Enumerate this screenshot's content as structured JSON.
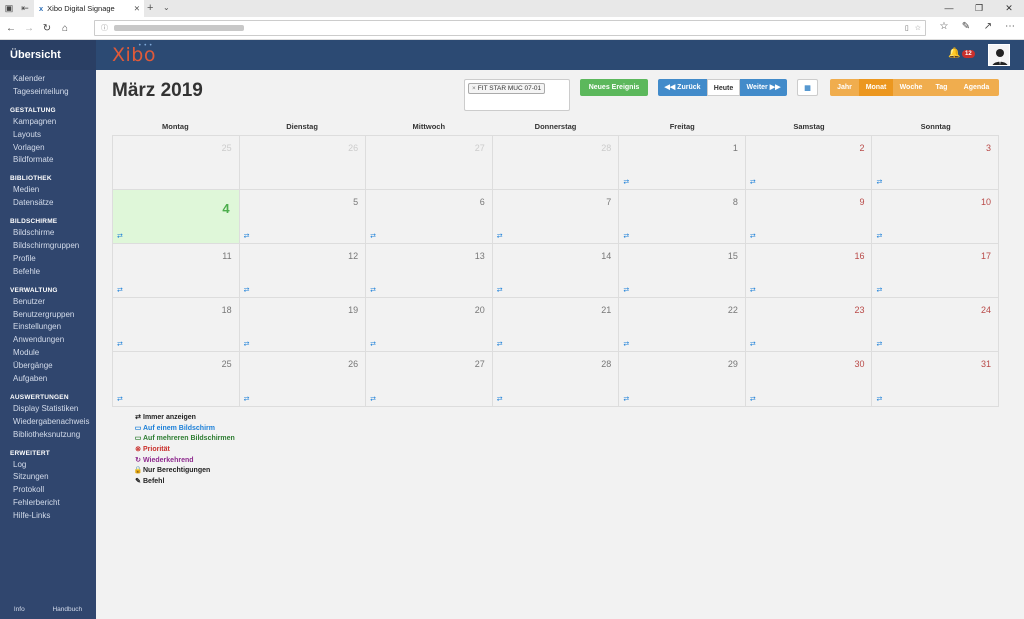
{
  "browser": {
    "tab_title": "Xibo Digital Signage",
    "tab_close": "✕",
    "new_tab": "+",
    "tab_dropdown": "⌄",
    "window_controls": [
      "—",
      "❐",
      "✕"
    ]
  },
  "sidebar": {
    "title": "Übersicht",
    "sections": [
      {
        "heading": "",
        "items": [
          "Kalender",
          "Tageseinteilung"
        ]
      },
      {
        "heading": "GESTALTUNG",
        "items": [
          "Kampagnen",
          "Layouts",
          "Vorlagen",
          "Bildformate"
        ]
      },
      {
        "heading": "BIBLIOTHEK",
        "items": [
          "Medien",
          "Datensätze"
        ]
      },
      {
        "heading": "BILDSCHIRME",
        "items": [
          "Bildschirme",
          "Bildschirmgruppen",
          "Profile",
          "Befehle"
        ]
      },
      {
        "heading": "VERWALTUNG",
        "items": [
          "Benutzer",
          "Benutzergruppen",
          "Einstellungen",
          "Anwendungen",
          "Module",
          "Übergänge",
          "Aufgaben"
        ]
      },
      {
        "heading": "AUSWERTUNGEN",
        "items": [
          "Display Statistiken",
          "Wiedergabenachweis",
          "Bibliotheksnutzung"
        ]
      },
      {
        "heading": "ERWEITERT",
        "items": [
          "Log",
          "Sitzungen",
          "Protokoll",
          "Fehlerbericht",
          "Hilfe-Links"
        ]
      }
    ],
    "footer": {
      "info": "Info",
      "manual": "Handbuch"
    }
  },
  "header": {
    "logo": "Xibo",
    "notification_count": "12"
  },
  "calendar": {
    "title": "März 2019",
    "filter_tag": "FIT STAR MUC 07-01",
    "filter_remove": "×",
    "new_event": "Neues Ereignis",
    "prev": "◀◀ Zurück",
    "today": "Heute",
    "next": "Weiter ▶▶",
    "views": [
      "Jahr",
      "Monat",
      "Woche",
      "Tag",
      "Agenda"
    ],
    "active_view": "Monat",
    "weekdays": [
      "Montag",
      "Dienstag",
      "Mittwoch",
      "Donnerstag",
      "Freitag",
      "Samstag",
      "Sonntag"
    ],
    "weeks": [
      [
        {
          "n": "25",
          "o": true,
          "e": false
        },
        {
          "n": "26",
          "o": true,
          "e": false
        },
        {
          "n": "27",
          "o": true,
          "e": false
        },
        {
          "n": "28",
          "o": true,
          "e": false
        },
        {
          "n": "1",
          "e": true
        },
        {
          "n": "2",
          "e": true
        },
        {
          "n": "3",
          "e": true
        }
      ],
      [
        {
          "n": "4",
          "today": true,
          "e": true
        },
        {
          "n": "5",
          "e": true
        },
        {
          "n": "6",
          "e": true
        },
        {
          "n": "7",
          "e": true
        },
        {
          "n": "8",
          "e": true
        },
        {
          "n": "9",
          "e": true
        },
        {
          "n": "10",
          "e": true
        }
      ],
      [
        {
          "n": "11",
          "e": true
        },
        {
          "n": "12",
          "e": true
        },
        {
          "n": "13",
          "e": true
        },
        {
          "n": "14",
          "e": true
        },
        {
          "n": "15",
          "e": true
        },
        {
          "n": "16",
          "e": true
        },
        {
          "n": "17",
          "e": true
        }
      ],
      [
        {
          "n": "18",
          "e": true
        },
        {
          "n": "19",
          "e": true
        },
        {
          "n": "20",
          "e": true
        },
        {
          "n": "21",
          "e": true
        },
        {
          "n": "22",
          "e": true
        },
        {
          "n": "23",
          "e": true
        },
        {
          "n": "24",
          "e": true
        }
      ],
      [
        {
          "n": "25",
          "e": true
        },
        {
          "n": "26",
          "e": true
        },
        {
          "n": "27",
          "e": true
        },
        {
          "n": "28",
          "e": true
        },
        {
          "n": "29",
          "e": true
        },
        {
          "n": "30",
          "e": true
        },
        {
          "n": "31",
          "e": true
        }
      ]
    ],
    "event_icon": "⇄",
    "legend": [
      {
        "icon": "⇄",
        "label": "Immer anzeigen",
        "color": "#222222",
        "icon_name": "always-icon"
      },
      {
        "icon": "▭",
        "label": "Auf einem Bildschirm",
        "color": "#1b7fd8",
        "icon_name": "single-display-icon"
      },
      {
        "icon": "▭",
        "label": "Auf mehreren Bildschirmen",
        "color": "#2e7d32",
        "icon_name": "multi-display-icon"
      },
      {
        "icon": "⊗",
        "label": "Priorität",
        "color": "#c9302c",
        "icon_name": "priority-icon"
      },
      {
        "icon": "↻",
        "label": "Wiederkehrend",
        "color": "#8e2b8e",
        "icon_name": "recurring-icon"
      },
      {
        "icon": "🔒",
        "label": "Nur Berechtigungen",
        "color": "#222222",
        "icon_name": "lock-icon"
      },
      {
        "icon": "✎",
        "label": "Befehl",
        "color": "#222222",
        "icon_name": "command-icon"
      }
    ]
  }
}
